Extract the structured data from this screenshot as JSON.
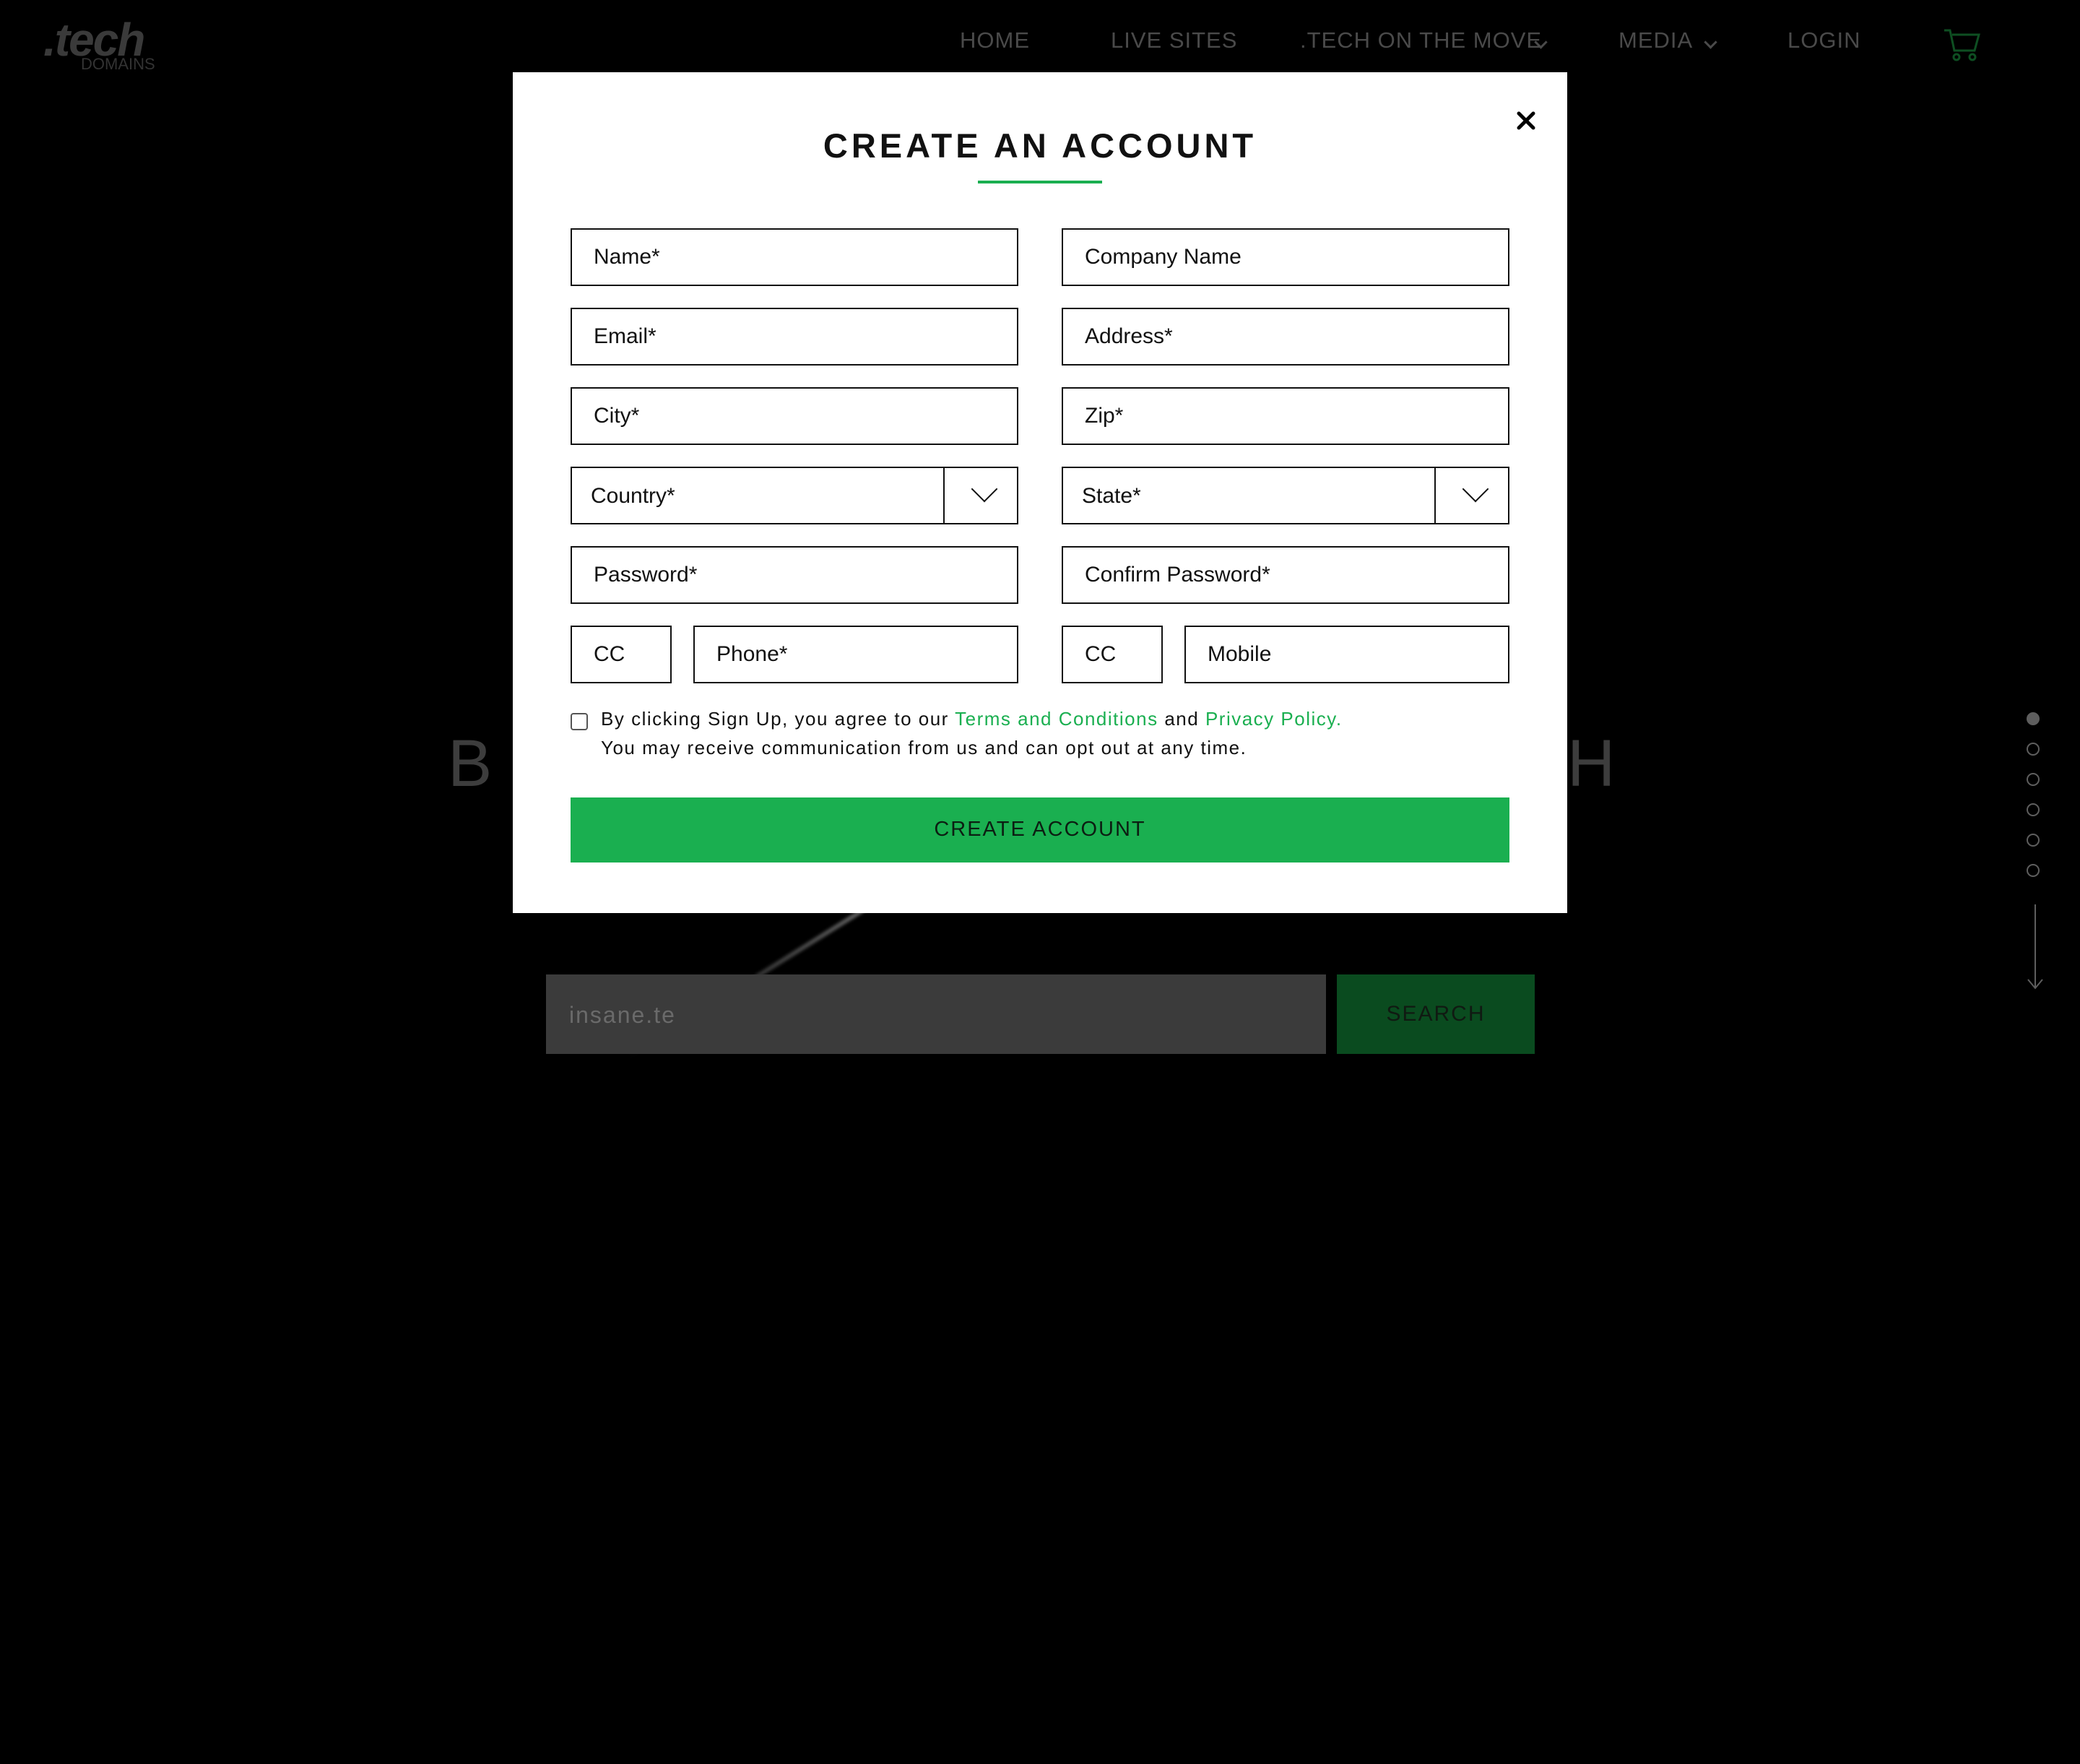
{
  "colors": {
    "accent": "#1aaf50",
    "background": "#000000",
    "modal": "#ffffff"
  },
  "logo": {
    "main": ".tech",
    "sub": "DOMAINS"
  },
  "nav": {
    "home": "HOME",
    "live_sites": "LIVE SITES",
    "on_the_move": ".TECH ON THE MOVE",
    "media": "MEDIA",
    "login": "LOGIN",
    "cart_icon": "cart-icon"
  },
  "hero": {
    "title_left": "B U",
    "title_right": "H"
  },
  "search": {
    "value": "insane.te",
    "button_label": "SEARCH"
  },
  "slider": {
    "count": 6,
    "active_index": 0
  },
  "modal": {
    "title": "CREATE AN ACCOUNT",
    "close_icon": "close-icon",
    "fields": {
      "name": "Name*",
      "company": "Company Name",
      "email": "Email*",
      "address": "Address*",
      "city": "City*",
      "zip": "Zip*",
      "country": "Country*",
      "state": "State*",
      "password": "Password*",
      "confirm_password": "Confirm Password*",
      "phone_cc": "CC",
      "phone": "Phone*",
      "mobile_cc": "CC",
      "mobile": "Mobile"
    },
    "agree": {
      "prefix": "By clicking Sign Up, you agree to our",
      "terms_link": "Terms and Conditions",
      "and": "and",
      "privacy_link": "Privacy Policy.",
      "line2": "You may receive communication from us and can opt out at any time."
    },
    "submit_label": "CREATE ACCOUNT"
  }
}
